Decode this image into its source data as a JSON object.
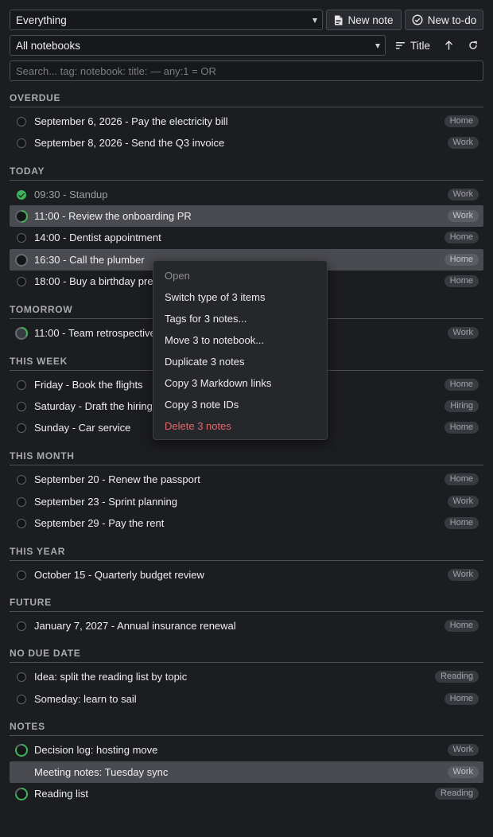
{
  "toolbar": {
    "filter_select": "Everything",
    "new_note_label": "New note",
    "new_todo_label": "New to-do",
    "notebook_select": "All notebooks",
    "sort_label": "Title"
  },
  "search": {
    "placeholder": "Search... tag: notebook: title: — any:1 = OR",
    "value": ""
  },
  "sections": {
    "overdue": "OVERDUE",
    "today": "TODAY",
    "tomorrow": "TOMORROW",
    "this_week": "THIS WEEK",
    "this_month": "THIS MONTH",
    "this_year": "THIS YEAR",
    "future": "FUTURE",
    "no_due_date": "NO DUE DATE",
    "notes": "NOTES"
  },
  "items": {
    "overdue": [
      {
        "title": "September 6, 2026 - Pay the electricity bill",
        "tag": "Home"
      },
      {
        "title": "September 8, 2026 - Send the Q3 invoice",
        "tag": "Work"
      }
    ],
    "today": [
      {
        "title": "09:30 - Standup",
        "tag": "Work",
        "done": true
      },
      {
        "title": "11:00 - Review the onboarding PR",
        "tag": "Work",
        "selected": true
      },
      {
        "title": "14:00 - Dentist appointment",
        "tag": "Home"
      },
      {
        "title": "16:30 - Call the plumber",
        "tag": "Home",
        "selected": true
      },
      {
        "title": "18:00 - Buy a birthday present",
        "tag": "Home"
      }
    ],
    "tomorrow": [
      {
        "title": "11:00 - Team retrospective",
        "tag": "Work"
      }
    ],
    "this_week": [
      {
        "title": "Friday - Book the flights",
        "tag": "Home"
      },
      {
        "title": "Saturday - Draft the hiring plan",
        "tag": "Hiring"
      },
      {
        "title": "Sunday - Car service",
        "tag": "Home"
      }
    ],
    "this_month": [
      {
        "title": "September 20 - Renew the passport",
        "tag": "Home"
      },
      {
        "title": "September 23 - Sprint planning",
        "tag": "Work"
      },
      {
        "title": "September 29 - Pay the rent",
        "tag": "Home"
      }
    ],
    "this_year": [
      {
        "title": "October 15 - Quarterly budget review",
        "tag": "Work"
      }
    ],
    "future": [
      {
        "title": "January 7, 2027 - Annual insurance renewal",
        "tag": "Home"
      }
    ],
    "no_due_date": [
      {
        "title": "Idea: split the reading list by topic",
        "tag": "Reading"
      },
      {
        "title": "Someday: learn to sail",
        "tag": "Home"
      }
    ],
    "notes": [
      {
        "title": "Decision log: hosting move",
        "tag": "Work"
      },
      {
        "title": "Meeting notes: Tuesday sync",
        "tag": "Work",
        "selected": true
      },
      {
        "title": "Reading list",
        "tag": "Reading"
      }
    ]
  },
  "context_menu": {
    "open": "Open",
    "switch_type": "Switch type of 3 items",
    "tags": "Tags for 3 notes...",
    "move": "Move 3 to notebook...",
    "duplicate": "Duplicate 3 notes",
    "copy_links": "Copy 3 Markdown links",
    "copy_ids": "Copy 3 note IDs",
    "delete": "Delete 3 notes"
  },
  "colors": {
    "accent_green": "#3fb35a",
    "danger": "#e8656a",
    "background": "#1c1d21"
  }
}
